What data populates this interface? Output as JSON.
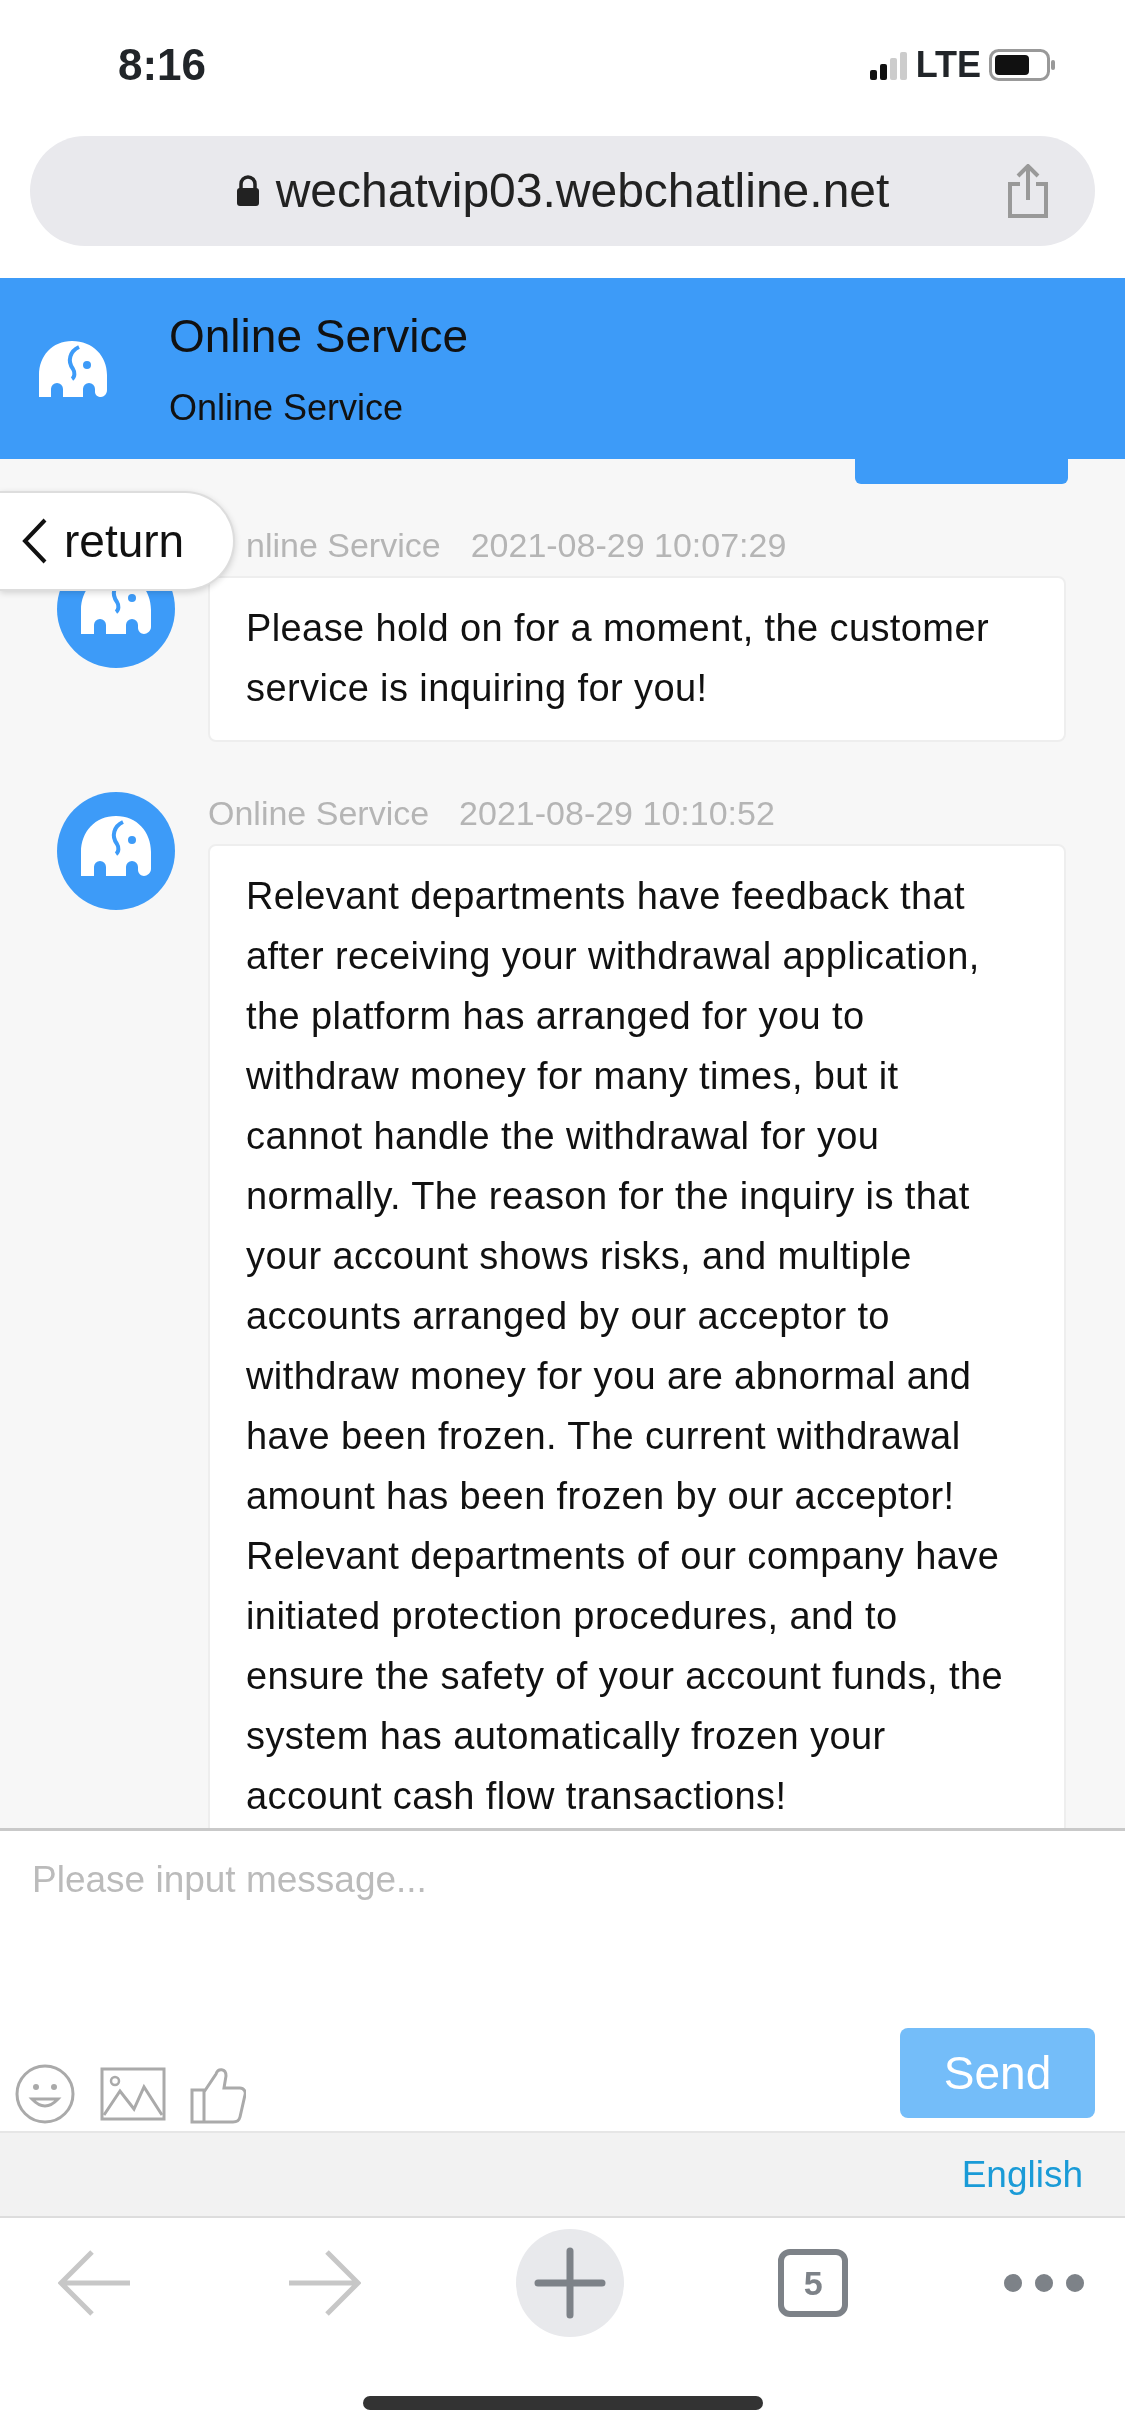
{
  "status_bar": {
    "time": "8:16",
    "network": "LTE"
  },
  "address_bar": {
    "url": "wechatvip03.webchatline.net"
  },
  "header": {
    "title": "Online Service",
    "subtitle": "Online Service"
  },
  "return_button": {
    "label": "return"
  },
  "messages": [
    {
      "sender": "nline Service",
      "time": "2021-08-29 10:07:29",
      "text": "Please hold on for a moment, the customer service is inquiring for you!"
    },
    {
      "sender": "Online Service",
      "time": "2021-08-29 10:10:52",
      "text": "Relevant departments have feedback that after receiving your withdrawal application, the platform has arranged for you to withdraw money for many times, but it cannot handle the withdrawal for you normally. The reason for the inquiry is that your account shows risks, and multiple accounts arranged by our acceptor to withdraw money for you are abnormal and have been frozen. The current withdrawal amount has been frozen by our acceptor! Relevant departments of our company have initiated protection procedures, and to ensure the safety of your account funds, the system has automatically frozen your account cash flow transactions!"
    }
  ],
  "composer": {
    "placeholder": "Please input message...",
    "send_button": "Send"
  },
  "language_link": "English",
  "browser_toolbar": {
    "tabs_count": "5"
  }
}
